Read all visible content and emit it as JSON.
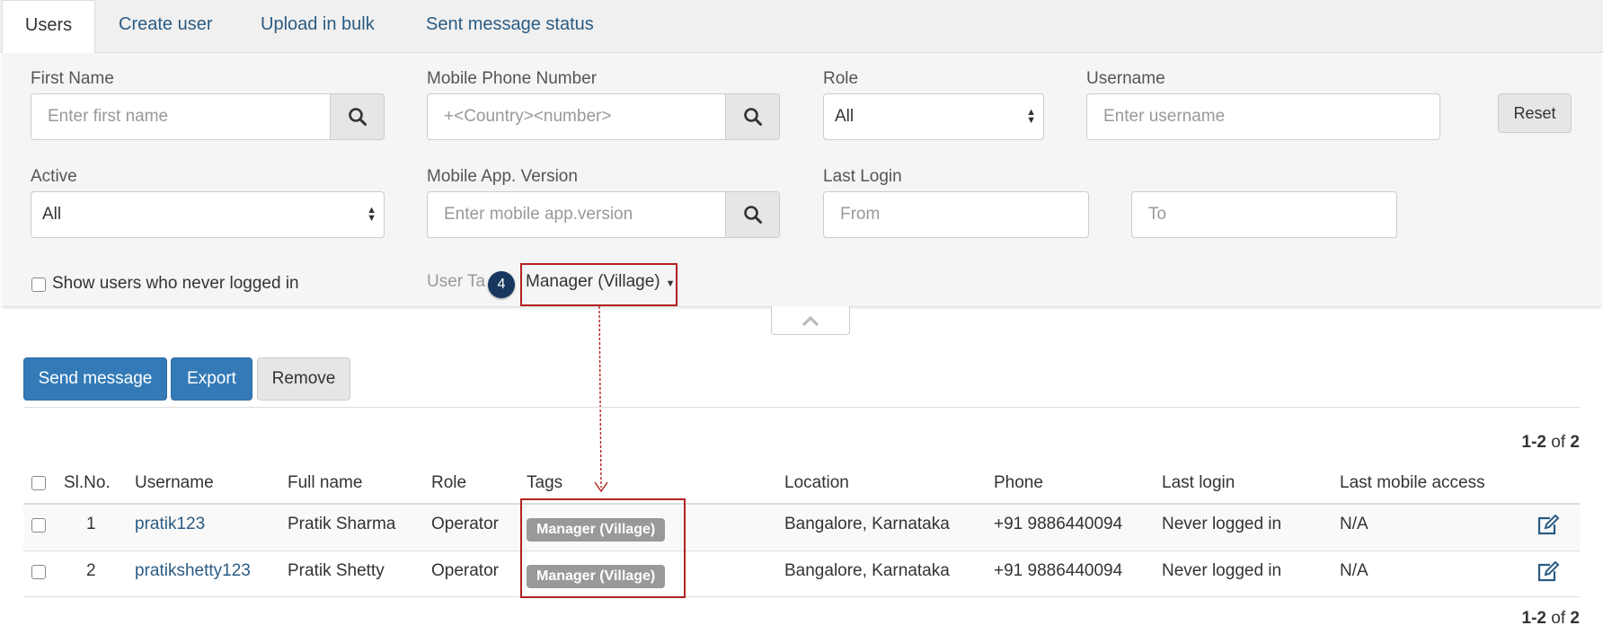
{
  "tabs": [
    {
      "label": "Users",
      "active": true
    },
    {
      "label": "Create user",
      "active": false
    },
    {
      "label": "Upload in bulk",
      "active": false
    },
    {
      "label": "Sent message status",
      "active": false
    }
  ],
  "filters": {
    "first_name": {
      "label": "First Name",
      "placeholder": "Enter first name"
    },
    "mobile_phone": {
      "label": "Mobile Phone Number",
      "placeholder": "+<Country><number>"
    },
    "role": {
      "label": "Role",
      "value": "All"
    },
    "username": {
      "label": "Username",
      "placeholder": "Enter username"
    },
    "reset_label": "Reset",
    "active": {
      "label": "Active",
      "value": "All"
    },
    "mobile_app_version": {
      "label": "Mobile App. Version",
      "placeholder": "Enter mobile app.version"
    },
    "last_login": {
      "label": "Last Login",
      "from_placeholder": "From",
      "to_placeholder": "To"
    },
    "never_logged_in_label": "Show users who never logged in",
    "user_tag": {
      "label": "User Ta",
      "value": "Manager (Village)"
    }
  },
  "callout": {
    "step": "4"
  },
  "actions": {
    "send_message": "Send message",
    "export": "Export",
    "remove": "Remove"
  },
  "pagination": {
    "range": "1-2",
    "of_text": "of",
    "total": "2"
  },
  "table": {
    "headers": {
      "slno": "Sl.No.",
      "username": "Username",
      "full_name": "Full name",
      "role": "Role",
      "tags": "Tags",
      "location": "Location",
      "phone": "Phone",
      "last_login": "Last login",
      "last_mobile_access": "Last mobile access"
    },
    "rows": [
      {
        "slno": "1",
        "username": "pratik123",
        "full_name": "Pratik Sharma",
        "role": "Operator",
        "tag": "Manager (Village)",
        "location": "Bangalore, Karnataka",
        "phone": "+91 9886440094",
        "last_login": "Never logged in",
        "last_mobile_access": "N/A"
      },
      {
        "slno": "2",
        "username": "pratikshetty123",
        "full_name": "Pratik Shetty",
        "role": "Operator",
        "tag": "Manager (Village)",
        "location": "Bangalore, Karnataka",
        "phone": "+91 9886440094",
        "last_login": "Never logged in",
        "last_mobile_access": "N/A"
      }
    ]
  },
  "icons": {
    "search": "search-icon",
    "edit": "edit-icon",
    "chevron_up": "chevron-up-icon",
    "caret_down": "caret-down-icon"
  },
  "colors": {
    "primary": "#337ab7",
    "link": "#2a5b83",
    "callout": "#b22222",
    "badge": "#17375e",
    "tag": "#999999"
  }
}
